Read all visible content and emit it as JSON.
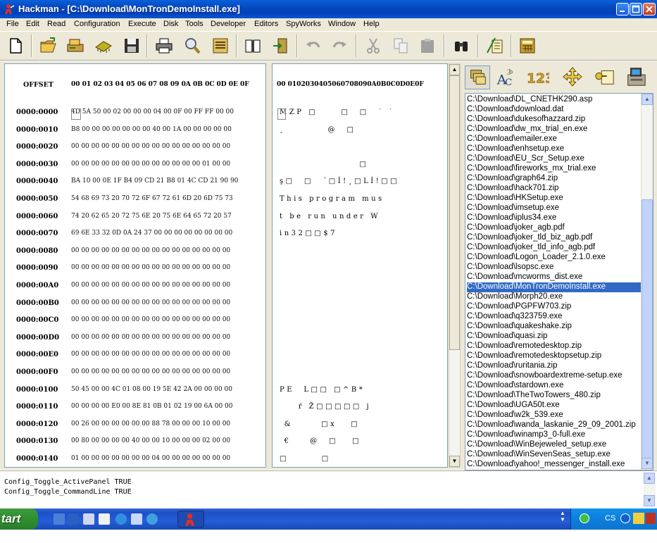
{
  "window": {
    "title": "Hackman - [C:\\Download\\MonTronDemoInstall.exe]"
  },
  "menu": [
    "File",
    "Edit",
    "Read",
    "Configuration",
    "Execute",
    "Disk",
    "Tools",
    "Developer",
    "Editors",
    "SpyWorks",
    "Window",
    "Help"
  ],
  "toolbar": {
    "icons": [
      "new-file-icon",
      "open-folder-icon",
      "open-drive-icon",
      "memory-chip-icon",
      "save-disk-icon",
      "print-icon",
      "find-icon",
      "calculator-bars-icon",
      "book-icon",
      "exit-door-icon",
      "undo-icon",
      "redo-icon",
      "cut-icon",
      "copy-icon",
      "paste-icon",
      "binoculars-icon",
      "ruler-icon",
      "calculator-icon"
    ]
  },
  "hex": {
    "offset_header": "OFFSET",
    "byte_header": "00 01 02 03 04 05 06 07 08 09 0A 0B 0C 0D 0E 0F",
    "ascii_header": "00 0102030405060708090A0B0C0D0E0F",
    "rows": [
      {
        "offset": "0000:0000",
        "bytes": "4D 5A 50 00 02 00 00 00 04 00 0F 00 FF FF 00 00",
        "ascii": "MZP □     □  □  ˙ ˙"
      },
      {
        "offset": "0000:0010",
        "bytes": "B8 00 00 00 00 00 00 00 40 00 1A 00 00 00 00 00",
        "ascii": "¸         @  □"
      },
      {
        "offset": "0000:0020",
        "bytes": "00 00 00 00 00 00 00 00 00 00 00 00 00 00 00 00",
        "ascii": ""
      },
      {
        "offset": "0000:0030",
        "bytes": "00 00 00 00 00 00 00 00 00 00 00 00 00 01 00 00",
        "ascii": "                 □"
      },
      {
        "offset": "0000:0040",
        "bytes": "BA 10 00 0E 1F B4 09 CD 21 B8 01 4C CD 21 90 90",
        "ascii": "ş□  □  ´□Í!¸□LÍ!□□"
      },
      {
        "offset": "0000:0050",
        "bytes": "54 68 69 73 20 70 72 6F 67 72 61 6D 20 6D 75 73",
        "ascii": "This program mus"
      },
      {
        "offset": "0000:0060",
        "bytes": "74 20 62 65 20 72 75 6E 20 75 6E 64 65 72 20 57",
        "ascii": "t be run under W"
      },
      {
        "offset": "0000:0070",
        "bytes": "69 6E 33 32 0D 0A 24 37 00 00 00 00 00 00 00 00",
        "ascii": "in32□□$7"
      },
      {
        "offset": "0000:0080",
        "bytes": "00 00 00 00 00 00 00 00 00 00 00 00 00 00 00 00",
        "ascii": ""
      },
      {
        "offset": "0000:0090",
        "bytes": "00 00 00 00 00 00 00 00 00 00 00 00 00 00 00 00",
        "ascii": ""
      },
      {
        "offset": "0000:00A0",
        "bytes": "00 00 00 00 00 00 00 00 00 00 00 00 00 00 00 00",
        "ascii": ""
      },
      {
        "offset": "0000:00B0",
        "bytes": "00 00 00 00 00 00 00 00 00 00 00 00 00 00 00 00",
        "ascii": ""
      },
      {
        "offset": "0000:00C0",
        "bytes": "00 00 00 00 00 00 00 00 00 00 00 00 00 00 00 00",
        "ascii": ""
      },
      {
        "offset": "0000:00D0",
        "bytes": "00 00 00 00 00 00 00 00 00 00 00 00 00 00 00 00",
        "ascii": ""
      },
      {
        "offset": "0000:00E0",
        "bytes": "00 00 00 00 00 00 00 00 00 00 00 00 00 00 00 00",
        "ascii": ""
      },
      {
        "offset": "0000:00F0",
        "bytes": "00 00 00 00 00 00 00 00 00 00 00 00 00 00 00 00",
        "ascii": ""
      },
      {
        "offset": "0000:0100",
        "bytes": "50 45 00 00 4C 01 08 00 19 5E 42 2A 00 00 00 00",
        "ascii": "PE  L□□ □^B*"
      },
      {
        "offset": "0000:0110",
        "bytes": "00 00 00 00 E0 00 8E 81 0B 01 02 19 00 6A 00 00",
        "ascii": "    ŕ Ž□□□□□ j"
      },
      {
        "offset": "0000:0120",
        "bytes": "00 26 00 00 00 00 00 00 88 78 00 00 00 10 00 00",
        "ascii": " &      □x   □"
      },
      {
        "offset": "0000:0130",
        "bytes": "00 80 00 00 00 00 40 00 00 10 00 00 00 02 00 00",
        "ascii": " €    @  □   □"
      },
      {
        "offset": "0000:0140",
        "bytes": "01 00 00 00 00 00 00 00 04 00 00 00 00 00 00 00",
        "ascii": "□       □"
      }
    ]
  },
  "files": [
    "C:\\Download\\DL_CNETHK290.asp",
    "C:\\Download\\download.dat",
    "C:\\Download\\dukesofhazzard.zip",
    "C:\\Download\\dw_mx_trial_en.exe",
    "C:\\Download\\emailer.exe",
    "C:\\Download\\enhsetup.exe",
    "C:\\Download\\EU_Scr_Setup.exe",
    "C:\\Download\\fireworks_mx_trial.exe",
    "C:\\Download\\graph64.zip",
    "C:\\Download\\hack701.zip",
    "C:\\Download\\HKSetup.exe",
    "C:\\Download\\imsetup.exe",
    "C:\\Download\\iplus34.exe",
    "C:\\Download\\joker_agb.pdf",
    "C:\\Download\\joker_tld_biz_agb.pdf",
    "C:\\Download\\joker_tld_info_agb.pdf",
    "C:\\Download\\Logon_Loader_2.1.0.exe",
    "C:\\Download\\lsopsc.exe",
    "C:\\Download\\mcworms_dist.exe",
    "C:\\Download\\MonTronDemoInstall.exe",
    "C:\\Download\\Morph20.exe",
    "C:\\Download\\PGPFW703.zip",
    "C:\\Download\\q323759.exe",
    "C:\\Download\\quakeshake.zip",
    "C:\\Download\\quasi.zip",
    "C:\\Download\\remotedesktop.zip",
    "C:\\Download\\remotedesktopsetup.zip",
    "C:\\Download\\ruritania.zip",
    "C:\\Download\\snowboardextreme-setup.exe",
    "C:\\Download\\stardown.exe",
    "C:\\Download\\TheTwoTowers_480.zip",
    "C:\\Download\\UGA50t.exe",
    "C:\\Download\\w2k_539.exe",
    "C:\\Download\\wanda_laskanie_29_09_2001.zip",
    "C:\\Download\\winamp3_0-full.exe",
    "C:\\Download\\WinBejeweled_setup.exe",
    "C:\\Download\\WinSevenSeas_setup.exe",
    "C:\\Download\\yahoo!_messenger_install.exe"
  ],
  "selected_file_index": 19,
  "right_icons": [
    "layers-icon",
    "abc-text-icon",
    "numbers-123-icon",
    "move-arrows-icon",
    "key-note-icon",
    "computer-icon"
  ],
  "command_output": [
    "Config_Toggle_ActivePanel TRUE",
    "Config_Toggle_CommandLine TRUE"
  ],
  "taskbar": {
    "start_label": "tart",
    "lang": "CS"
  },
  "colors": {
    "selection": "#316ac5",
    "titlebar": "#0548c0",
    "chrome": "#ece9d8"
  }
}
